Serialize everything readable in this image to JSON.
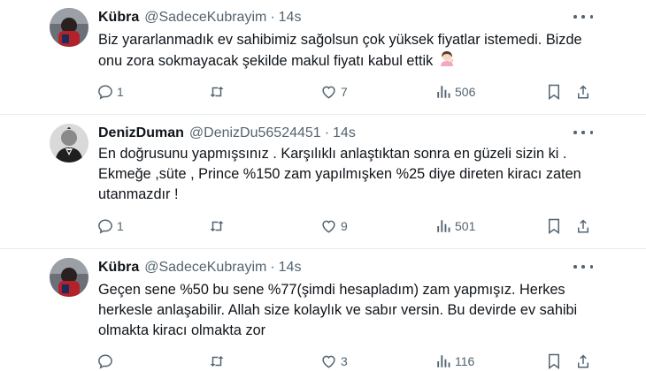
{
  "tweets": [
    {
      "name": "Kübra",
      "handle": "@SadeceKubrayim",
      "dot": "·",
      "time": "14s",
      "text": "Biz yararlanmadık ev sahibimiz sağolsun çok yüksek fiyatlar istemedi. Bizde onu zora sokmayacak şekilde makul fiyatı kabul ettik",
      "emoji": "woman-tipping-hand-emoji",
      "replies": "1",
      "retweets": "",
      "likes": "7",
      "views": "506"
    },
    {
      "name": "DenizDuman",
      "handle": "@DenizDu56524451",
      "dot": "·",
      "time": "14s",
      "text": "En doğrusunu yapmışsınız . Karşılıklı anlaştıktan sonra en güzeli sizin ki . Ekmeğe ,süte , Prince %150 zam yapılmışken %25 diye direten kiracı zaten utanmazdır !",
      "replies": "1",
      "retweets": "",
      "likes": "9",
      "views": "501"
    },
    {
      "name": "Kübra",
      "handle": "@SadeceKubrayim",
      "dot": "·",
      "time": "14s",
      "text": "Geçen sene %50 bu sene %77(şimdi hesapladım) zam yapmışız. Herkes herkesle anlaşabilir. Allah size kolaylık ve sabır versin. Bu devirde ev sahibi olmakta kiracı olmakta zor",
      "replies": "",
      "retweets": "",
      "likes": "3",
      "views": "116"
    }
  ],
  "icons": {
    "reply": "reply-icon",
    "retweet": "retweet-icon",
    "like": "heart-icon",
    "views": "views-icon",
    "bookmark": "bookmark-icon",
    "share": "share-icon",
    "more": "more-icon"
  },
  "colors": {
    "text": "#0f1419",
    "secondary": "#536471",
    "divider": "#e6ecf0"
  }
}
